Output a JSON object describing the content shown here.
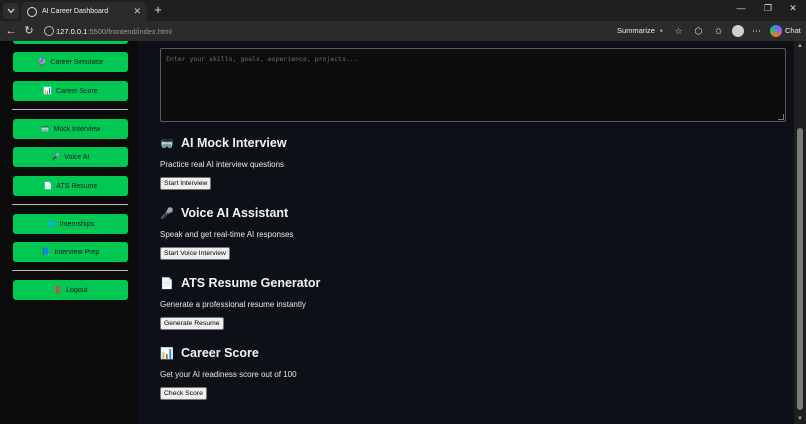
{
  "browser": {
    "tab_title": "AI Career Dashboard",
    "url_host": "127.0.0.1",
    "url_rest": ":5500/frontend/index.html",
    "summarize_label": "Summarize",
    "chat_label": "Chat"
  },
  "sidebar": {
    "items": [
      {
        "label": "Career Simulator",
        "icon": "🔮"
      },
      {
        "label": "Career Score",
        "icon": "📊"
      },
      {
        "label": "Mock Interview",
        "icon": "🥽"
      },
      {
        "label": "Voice AI",
        "icon": "🎤"
      },
      {
        "label": "ATS Resume",
        "icon": "📄"
      },
      {
        "label": "Internships",
        "icon": "🌐"
      },
      {
        "label": "Interview Prep",
        "icon": "📘"
      },
      {
        "label": "Logout",
        "icon": "🚪"
      }
    ]
  },
  "main": {
    "textarea_placeholder": "Enter your skills, goals, experience, projects...",
    "sections": [
      {
        "icon": "🥽",
        "title": "AI Mock Interview",
        "description": "Practice real AI interview questions",
        "button": "Start Interview"
      },
      {
        "icon": "🎤",
        "title": "Voice AI Assistant",
        "description": "Speak and get real-time AI responses",
        "button": "Start Voice Interview"
      },
      {
        "icon": "📄",
        "title": "ATS Resume Generator",
        "description": "Generate a professional resume instantly",
        "button": "Generate Resume"
      },
      {
        "icon": "📊",
        "title": "Career Score",
        "description": "Get your AI readiness score out of 100",
        "button": "Check Score"
      }
    ]
  },
  "colors": {
    "accent": "#00c853",
    "background": "#0d1117",
    "sidebar": "#0b0b0b"
  }
}
